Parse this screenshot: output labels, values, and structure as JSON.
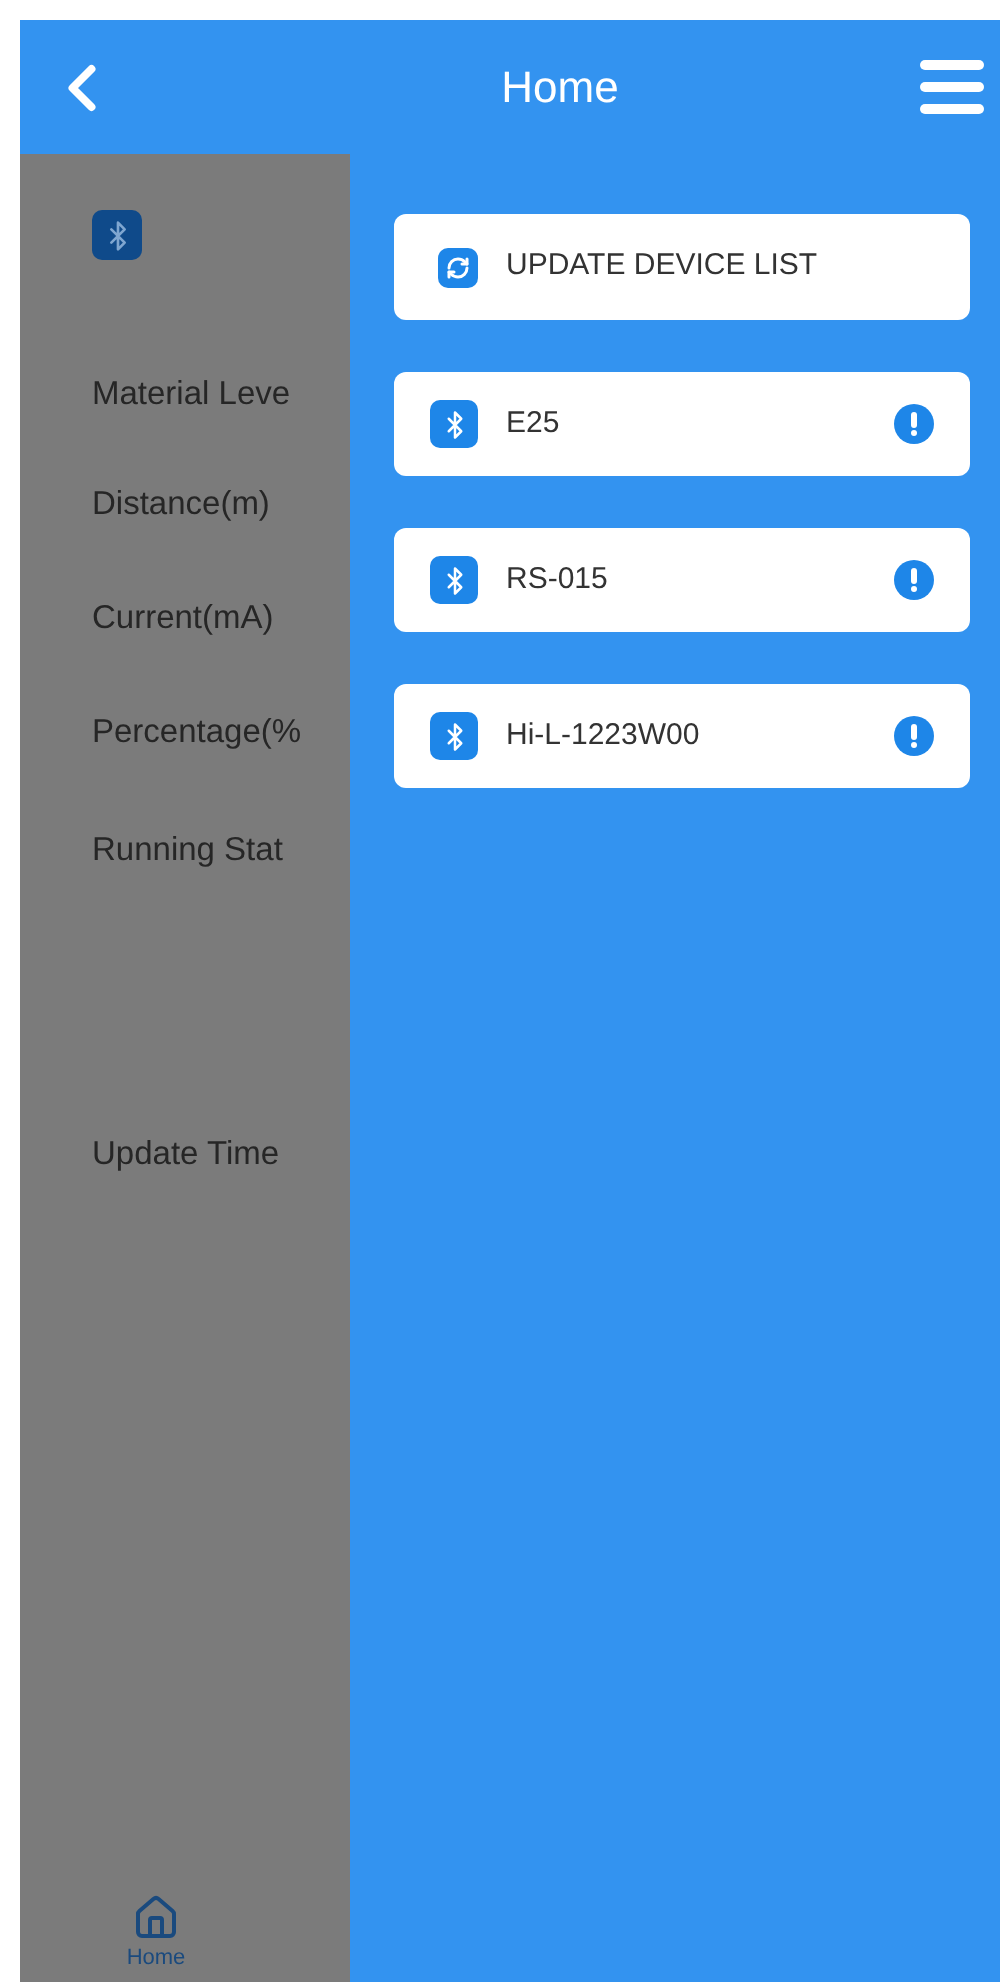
{
  "header": {
    "title": "Home"
  },
  "background": {
    "labels": [
      "Material Leve",
      "Distance(m)",
      "Current(mA)",
      "Percentage(%",
      "Running Stat",
      "Update Time"
    ],
    "nav": {
      "label": "Home"
    }
  },
  "drawer": {
    "update_button": "UPDATE DEVICE LIST",
    "devices": [
      {
        "name": "E25"
      },
      {
        "name": "RS-015"
      },
      {
        "name": "Hi-L-1223W00"
      }
    ]
  }
}
